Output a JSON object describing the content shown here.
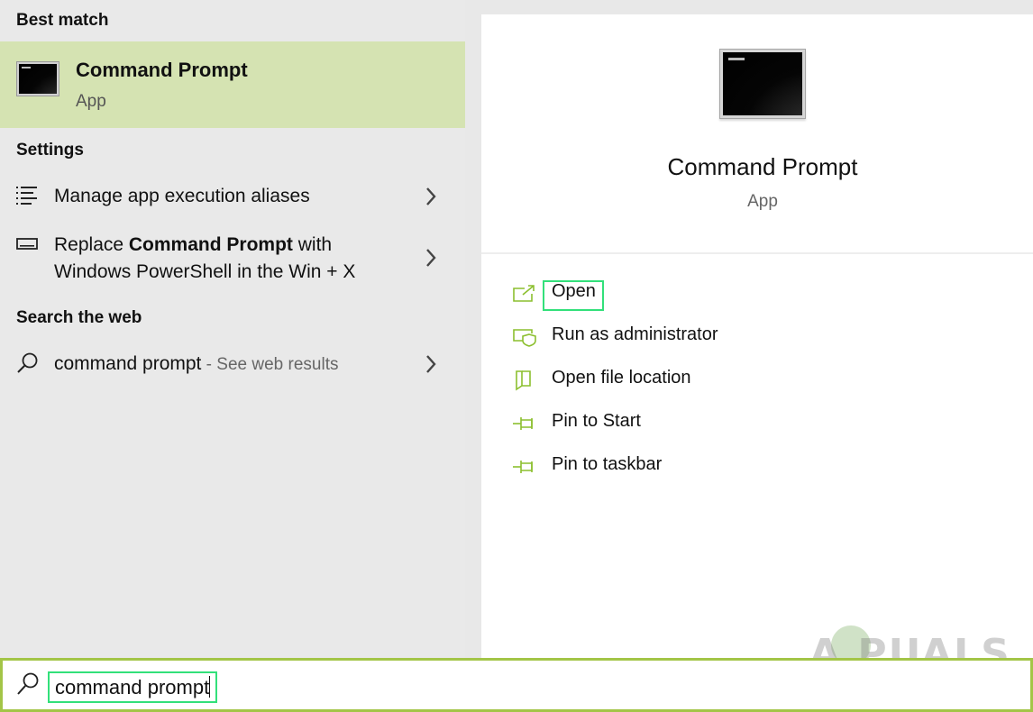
{
  "left": {
    "best_match_header": "Best match",
    "best_match": {
      "title": "Command Prompt",
      "subtitle": "App"
    },
    "settings_header": "Settings",
    "settings_items": [
      {
        "label": "Manage app execution aliases",
        "icon": "list-icon"
      },
      {
        "label_pre": "Replace ",
        "label_bold": "Command Prompt",
        "label_post": " with",
        "label_line2": "Windows PowerShell in the Win + X",
        "icon": "keyboard-icon"
      }
    ],
    "web_header": "Search the web",
    "web_item": {
      "query": "command prompt",
      "suffix": " - See web results",
      "icon": "search-icon"
    }
  },
  "right": {
    "title": "Command Prompt",
    "subtitle": "App",
    "actions": [
      {
        "label": "Open",
        "icon": "open-icon"
      },
      {
        "label": "Run as administrator",
        "icon": "shield-icon"
      },
      {
        "label": "Open file location",
        "icon": "folder-icon"
      },
      {
        "label": "Pin to Start",
        "icon": "pin-icon"
      },
      {
        "label": "Pin to taskbar",
        "icon": "pin-icon"
      }
    ]
  },
  "search": {
    "value": "command prompt",
    "icon": "search-icon"
  },
  "watermark": {
    "text": "A PUALS"
  },
  "colors": {
    "best_match_bg": "#d5e3b2",
    "accent_green": "#a3c547",
    "highlight_box": "#32e07a",
    "icon_green": "#8cbf2f"
  }
}
